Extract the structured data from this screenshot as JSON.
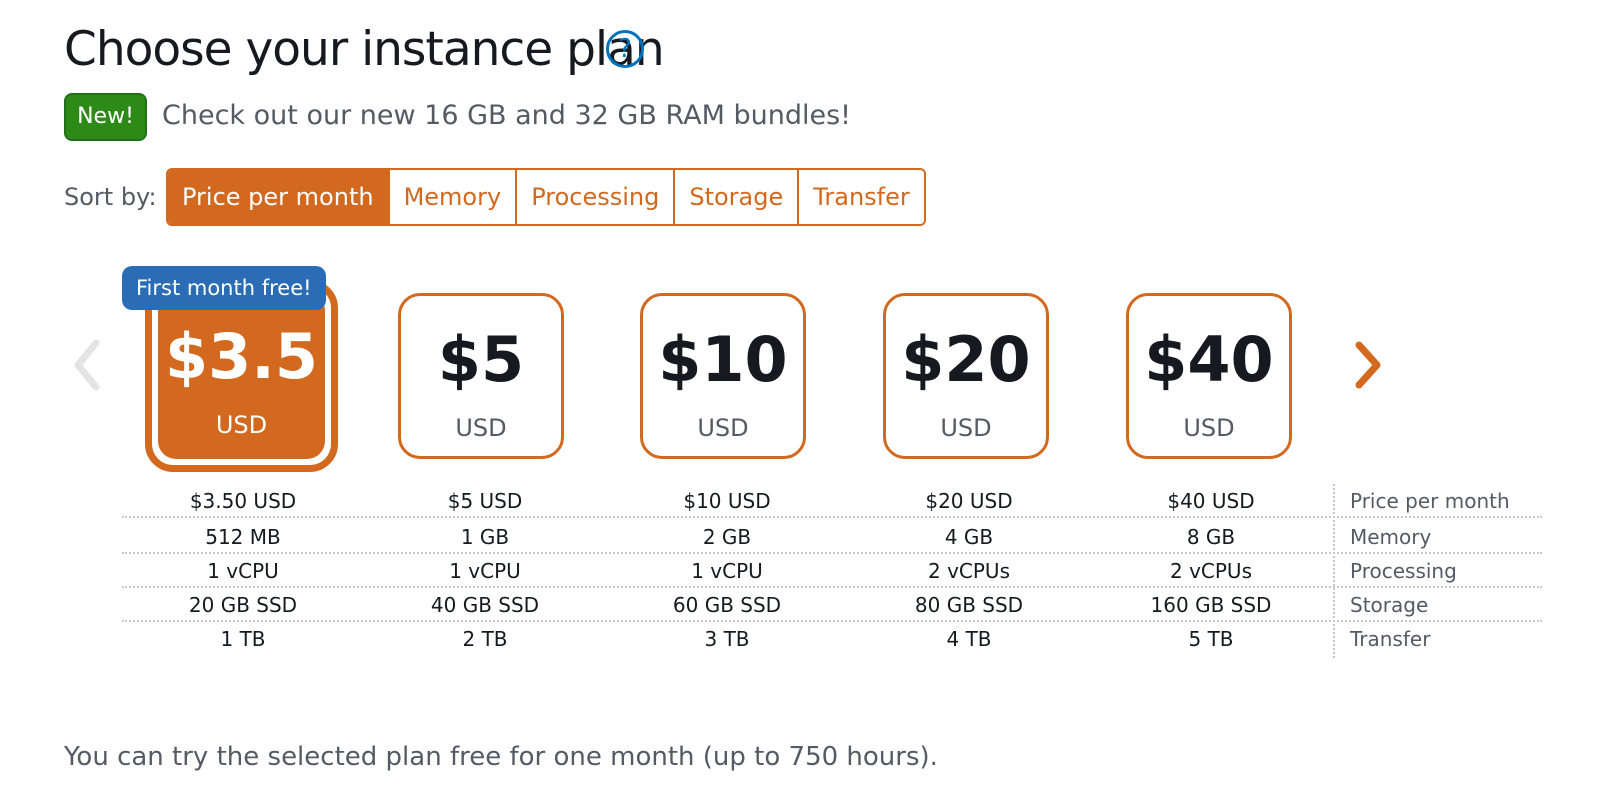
{
  "header": {
    "title": "Choose your instance plan",
    "help_icon": "question-circle-icon",
    "new_badge": "New!",
    "promo_text": "Check out our new 16 GB and 32 GB RAM bundles!"
  },
  "sort": {
    "label": "Sort by:",
    "options": [
      "Price per month",
      "Memory",
      "Processing",
      "Storage",
      "Transfer"
    ],
    "active": "Price per month"
  },
  "carousel": {
    "prev_icon": "chevron-left-icon",
    "next_icon": "chevron-right-icon",
    "promo_badge": "First month free!"
  },
  "plans": [
    {
      "price": "$3.5",
      "currency": "USD",
      "selected": true
    },
    {
      "price": "$5",
      "currency": "USD",
      "selected": false
    },
    {
      "price": "$10",
      "currency": "USD",
      "selected": false
    },
    {
      "price": "$20",
      "currency": "USD",
      "selected": false
    },
    {
      "price": "$40",
      "currency": "USD",
      "selected": false
    }
  ],
  "specs": {
    "labels": [
      "Price per month",
      "Memory",
      "Processing",
      "Storage",
      "Transfer"
    ],
    "rows": [
      [
        "$3.50 USD",
        "$5 USD",
        "$10 USD",
        "$20 USD",
        "$40 USD"
      ],
      [
        "512 MB",
        "1 GB",
        "2 GB",
        "4 GB",
        "8 GB"
      ],
      [
        "1 vCPU",
        "1 vCPU",
        "1 vCPU",
        "2 vCPUs",
        "2 vCPUs"
      ],
      [
        "20 GB SSD",
        "40 GB SSD",
        "60 GB SSD",
        "80 GB SSD",
        "160 GB SSD"
      ],
      [
        "1 TB",
        "2 TB",
        "3 TB",
        "4 TB",
        "5 TB"
      ]
    ]
  },
  "footer_text": "You can try the selected plan free for one month (up to 750 hours).",
  "colors": {
    "accent": "#d2691e",
    "new_badge": "#2e8a16",
    "free_badge": "#2a6cb5",
    "help": "#0073bb",
    "muted_text": "#545b64"
  }
}
